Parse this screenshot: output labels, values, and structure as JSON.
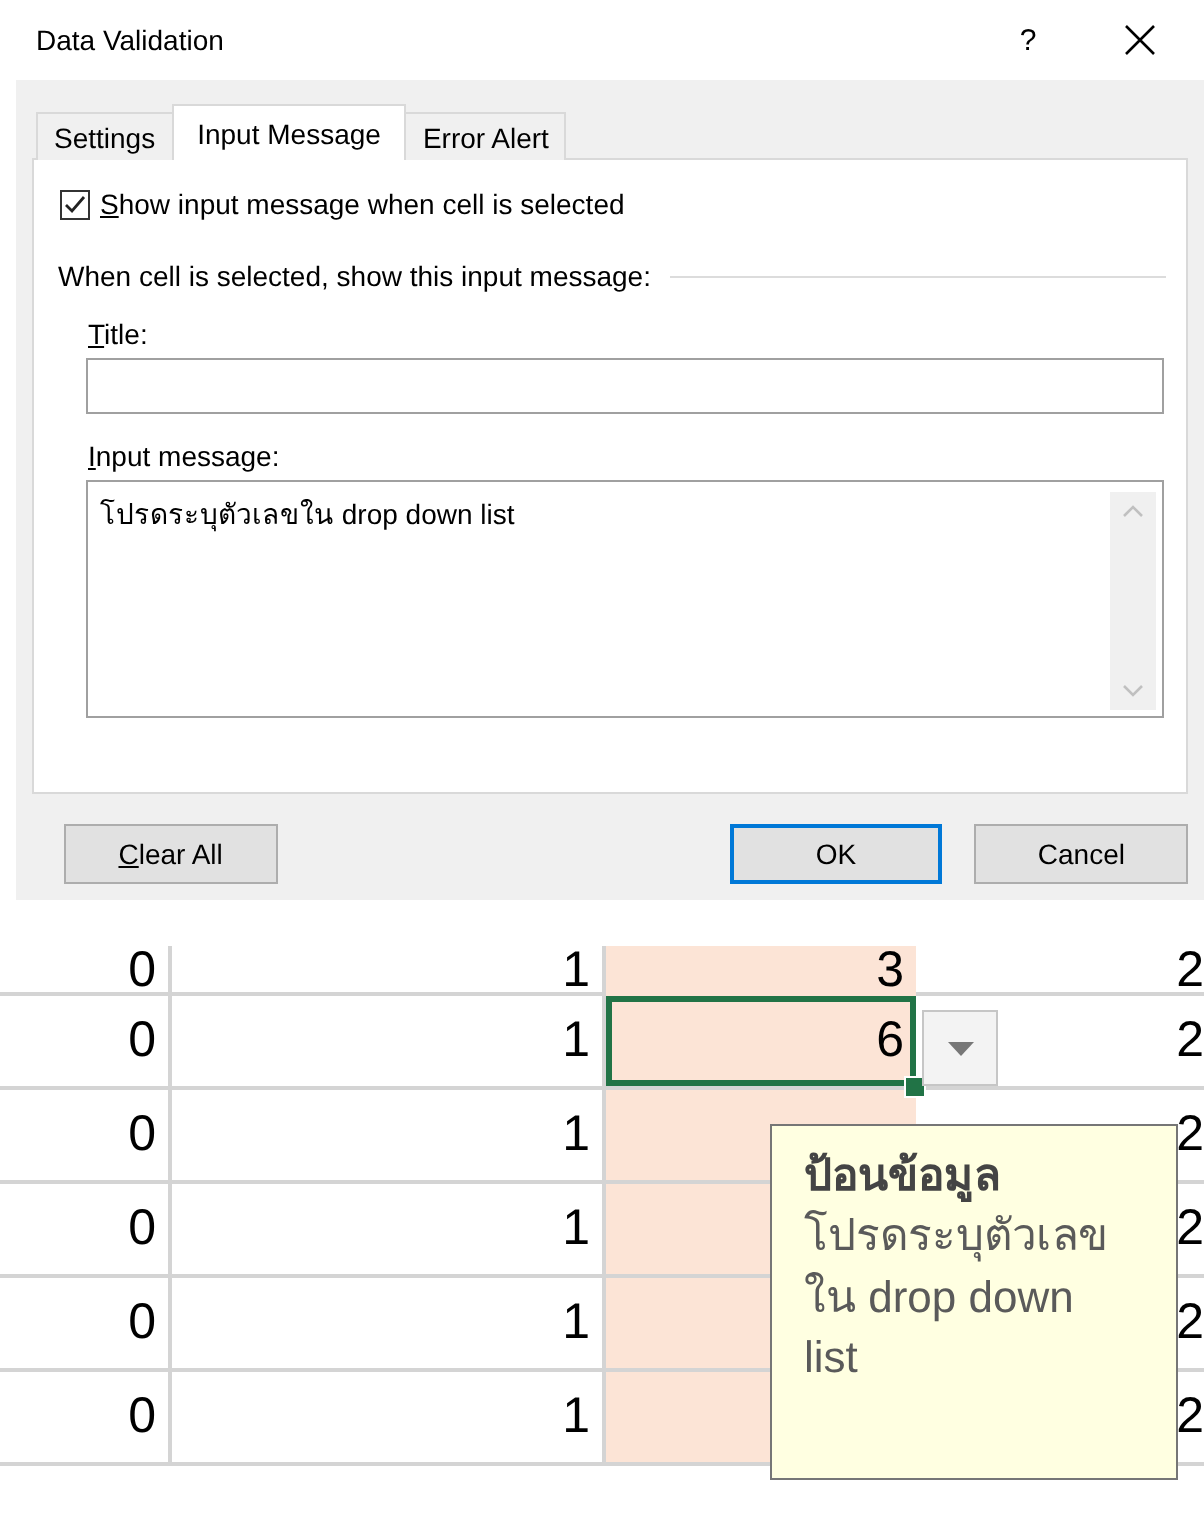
{
  "window": {
    "title": "Data Validation",
    "help": "?"
  },
  "tabs": [
    {
      "label": "Settings",
      "selected": false
    },
    {
      "label": "Input Message",
      "selected": true
    },
    {
      "label": "Error Alert",
      "selected": false
    }
  ],
  "show_message": {
    "label": "Show input message when cell is selected",
    "checked": true
  },
  "group_label": "When cell is selected, show this input message:",
  "title_field": {
    "label": "Title:"
  },
  "message_field": {
    "label": "Input message:",
    "value": "โปรดระบุตัวเลขใน drop down list"
  },
  "buttons": [
    {
      "label": "Clear All",
      "default": false
    },
    {
      "label": "OK",
      "default": true
    },
    {
      "label": "Cancel",
      "default": false
    }
  ],
  "sheet": {
    "rows": [
      {
        "cells": [
          "0",
          "1",
          "3",
          "2"
        ],
        "selected": false
      },
      {
        "cells": [
          "0",
          "1",
          "6",
          "2"
        ],
        "selected": true
      },
      {
        "cells": [
          "0",
          "1",
          "",
          "2"
        ],
        "selected": false
      },
      {
        "cells": [
          "0",
          "1",
          "",
          "2"
        ],
        "selected": false
      },
      {
        "cells": [
          "0",
          "1",
          "",
          "2"
        ],
        "selected": false
      },
      {
        "cells": [
          "0",
          "1",
          "",
          "2"
        ],
        "selected": false
      }
    ],
    "tooltip": {
      "title": "ป้อนข้อมูล",
      "message": "โปรดระบุตัวเลข ใน drop down list"
    }
  }
}
